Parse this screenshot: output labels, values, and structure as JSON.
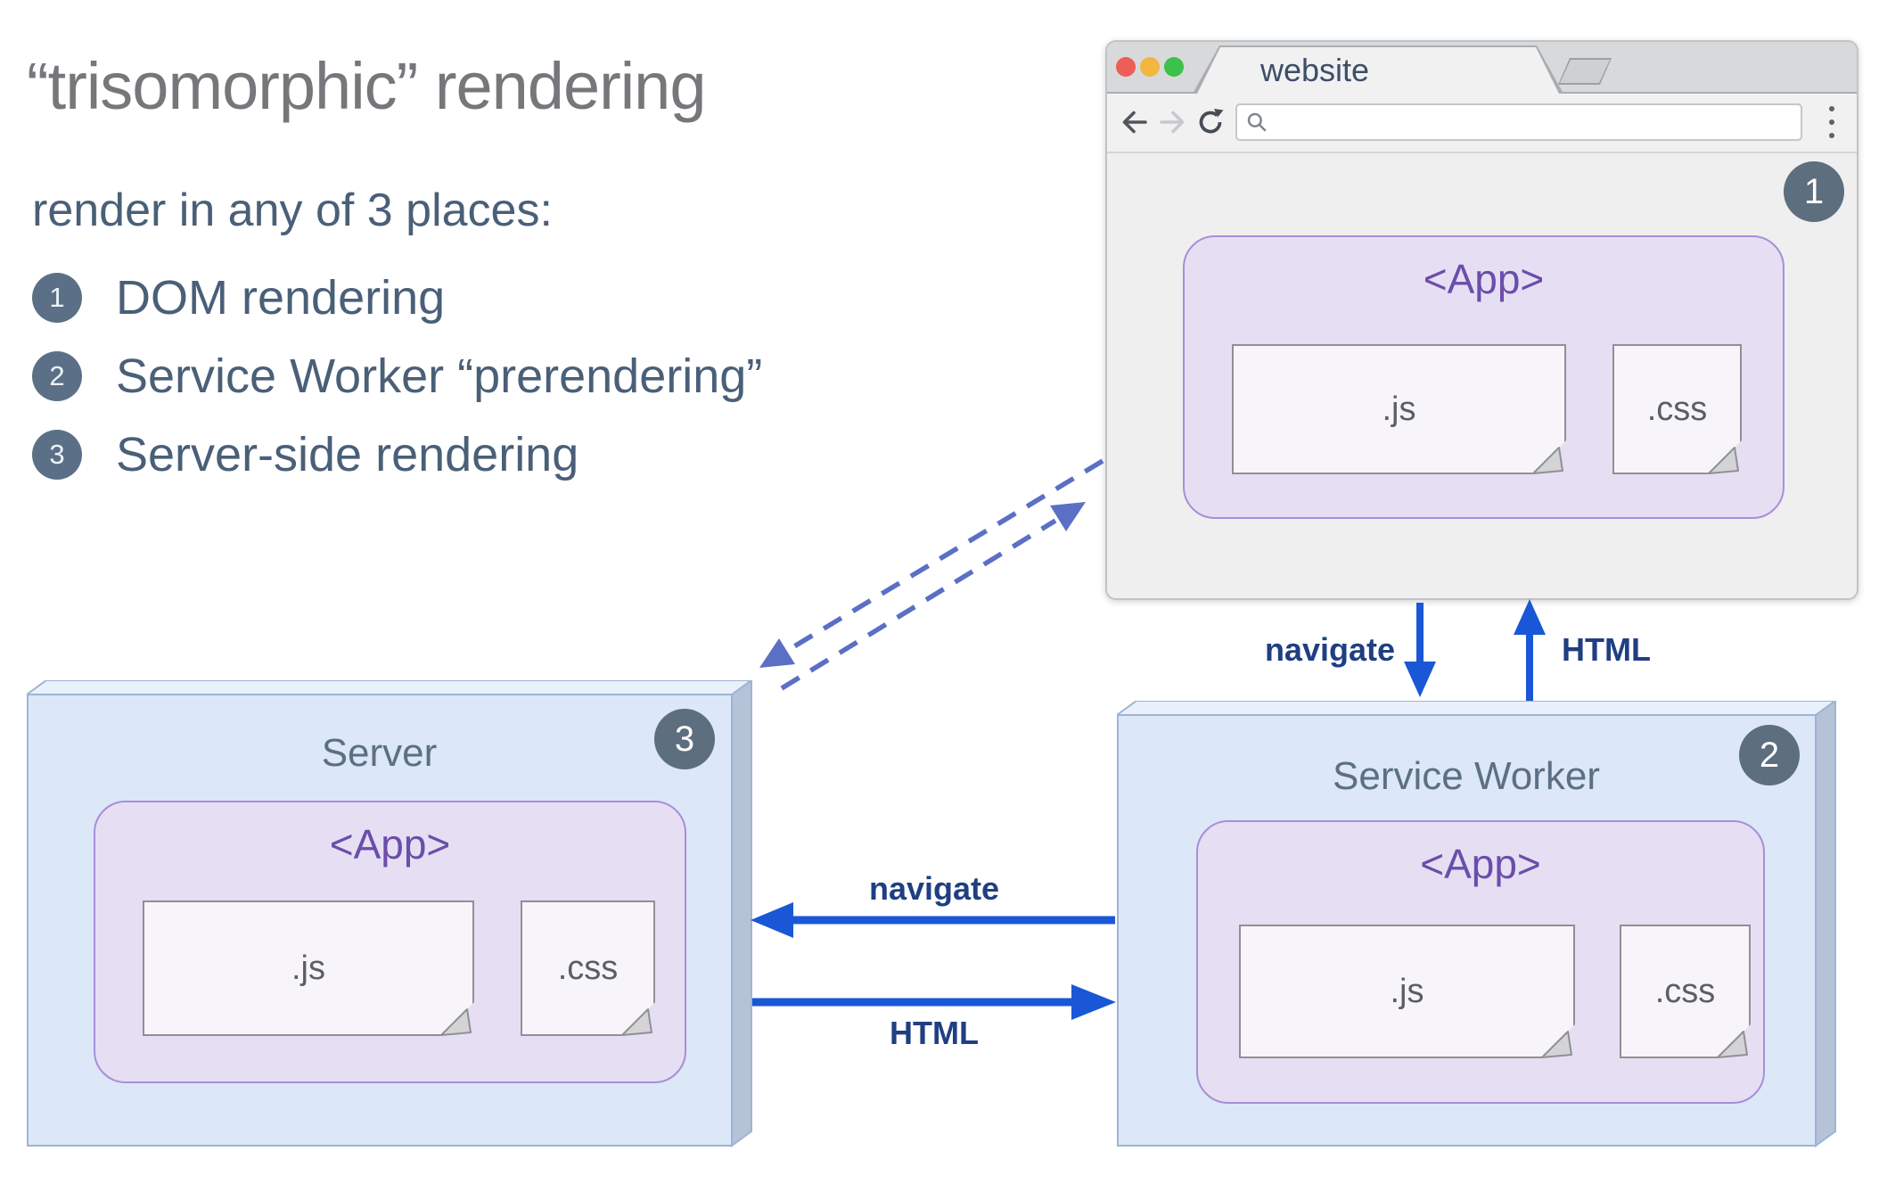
{
  "intro": {
    "title": "“trisomorphic” rendering",
    "subtitle": "render in any of 3 places:",
    "items": [
      {
        "number": "1",
        "label": "DOM rendering"
      },
      {
        "number": "2",
        "label": "Service Worker “prerendering”"
      },
      {
        "number": "3",
        "label": "Server-side rendering"
      }
    ]
  },
  "browser": {
    "tab_title": "website",
    "badge": "1",
    "app": {
      "label": "<App>",
      "js": ".js",
      "css": ".css"
    }
  },
  "server": {
    "title": "Server",
    "badge": "3",
    "app": {
      "label": "<App>",
      "js": ".js",
      "css": ".css"
    }
  },
  "service_worker": {
    "title": "Service Worker",
    "badge": "2",
    "app": {
      "label": "<App>",
      "js": ".js",
      "css": ".css"
    }
  },
  "arrows": {
    "browser_to_sw": "navigate",
    "sw_to_browser": "HTML",
    "sw_to_server": "navigate",
    "server_to_sw": "HTML"
  },
  "colors": {
    "arrow_blue": "#1a57d6",
    "dashed_blue": "#5b70c4",
    "label_navy": "#1f3f83",
    "badge_slate": "#5d6e7e",
    "app_purple_text": "#6b4dab",
    "app_bg": "#e6dff3",
    "app_border": "#a78fd6",
    "box_front": "#dce7f8",
    "box_top": "#e9f1fc",
    "box_side": "#b6c2d6",
    "traffic_red": "#ee5d56",
    "traffic_yellow": "#f1b73e",
    "traffic_green": "#3cc14a"
  }
}
